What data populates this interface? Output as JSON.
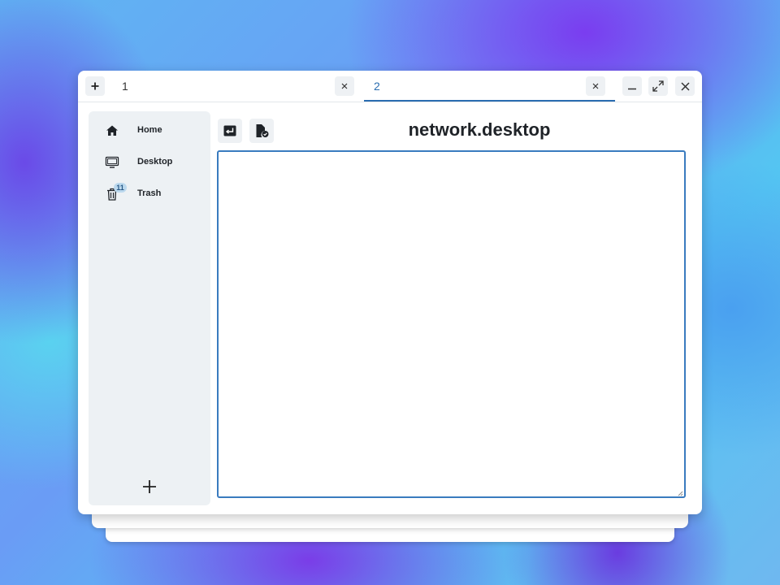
{
  "tabs": [
    {
      "label": "1",
      "active": false
    },
    {
      "label": "2",
      "active": true
    }
  ],
  "sidebar": {
    "items": [
      {
        "label": "Home",
        "icon": "home-icon"
      },
      {
        "label": "Desktop",
        "icon": "monitor-icon"
      },
      {
        "label": "Trash",
        "icon": "trash-icon",
        "badge": "11"
      }
    ]
  },
  "main": {
    "file_title": "network.desktop",
    "editor_value": ""
  },
  "colors": {
    "accent": "#2a6db0",
    "sidebar_bg": "#edf1f4",
    "button_bg": "#eef1f4"
  }
}
